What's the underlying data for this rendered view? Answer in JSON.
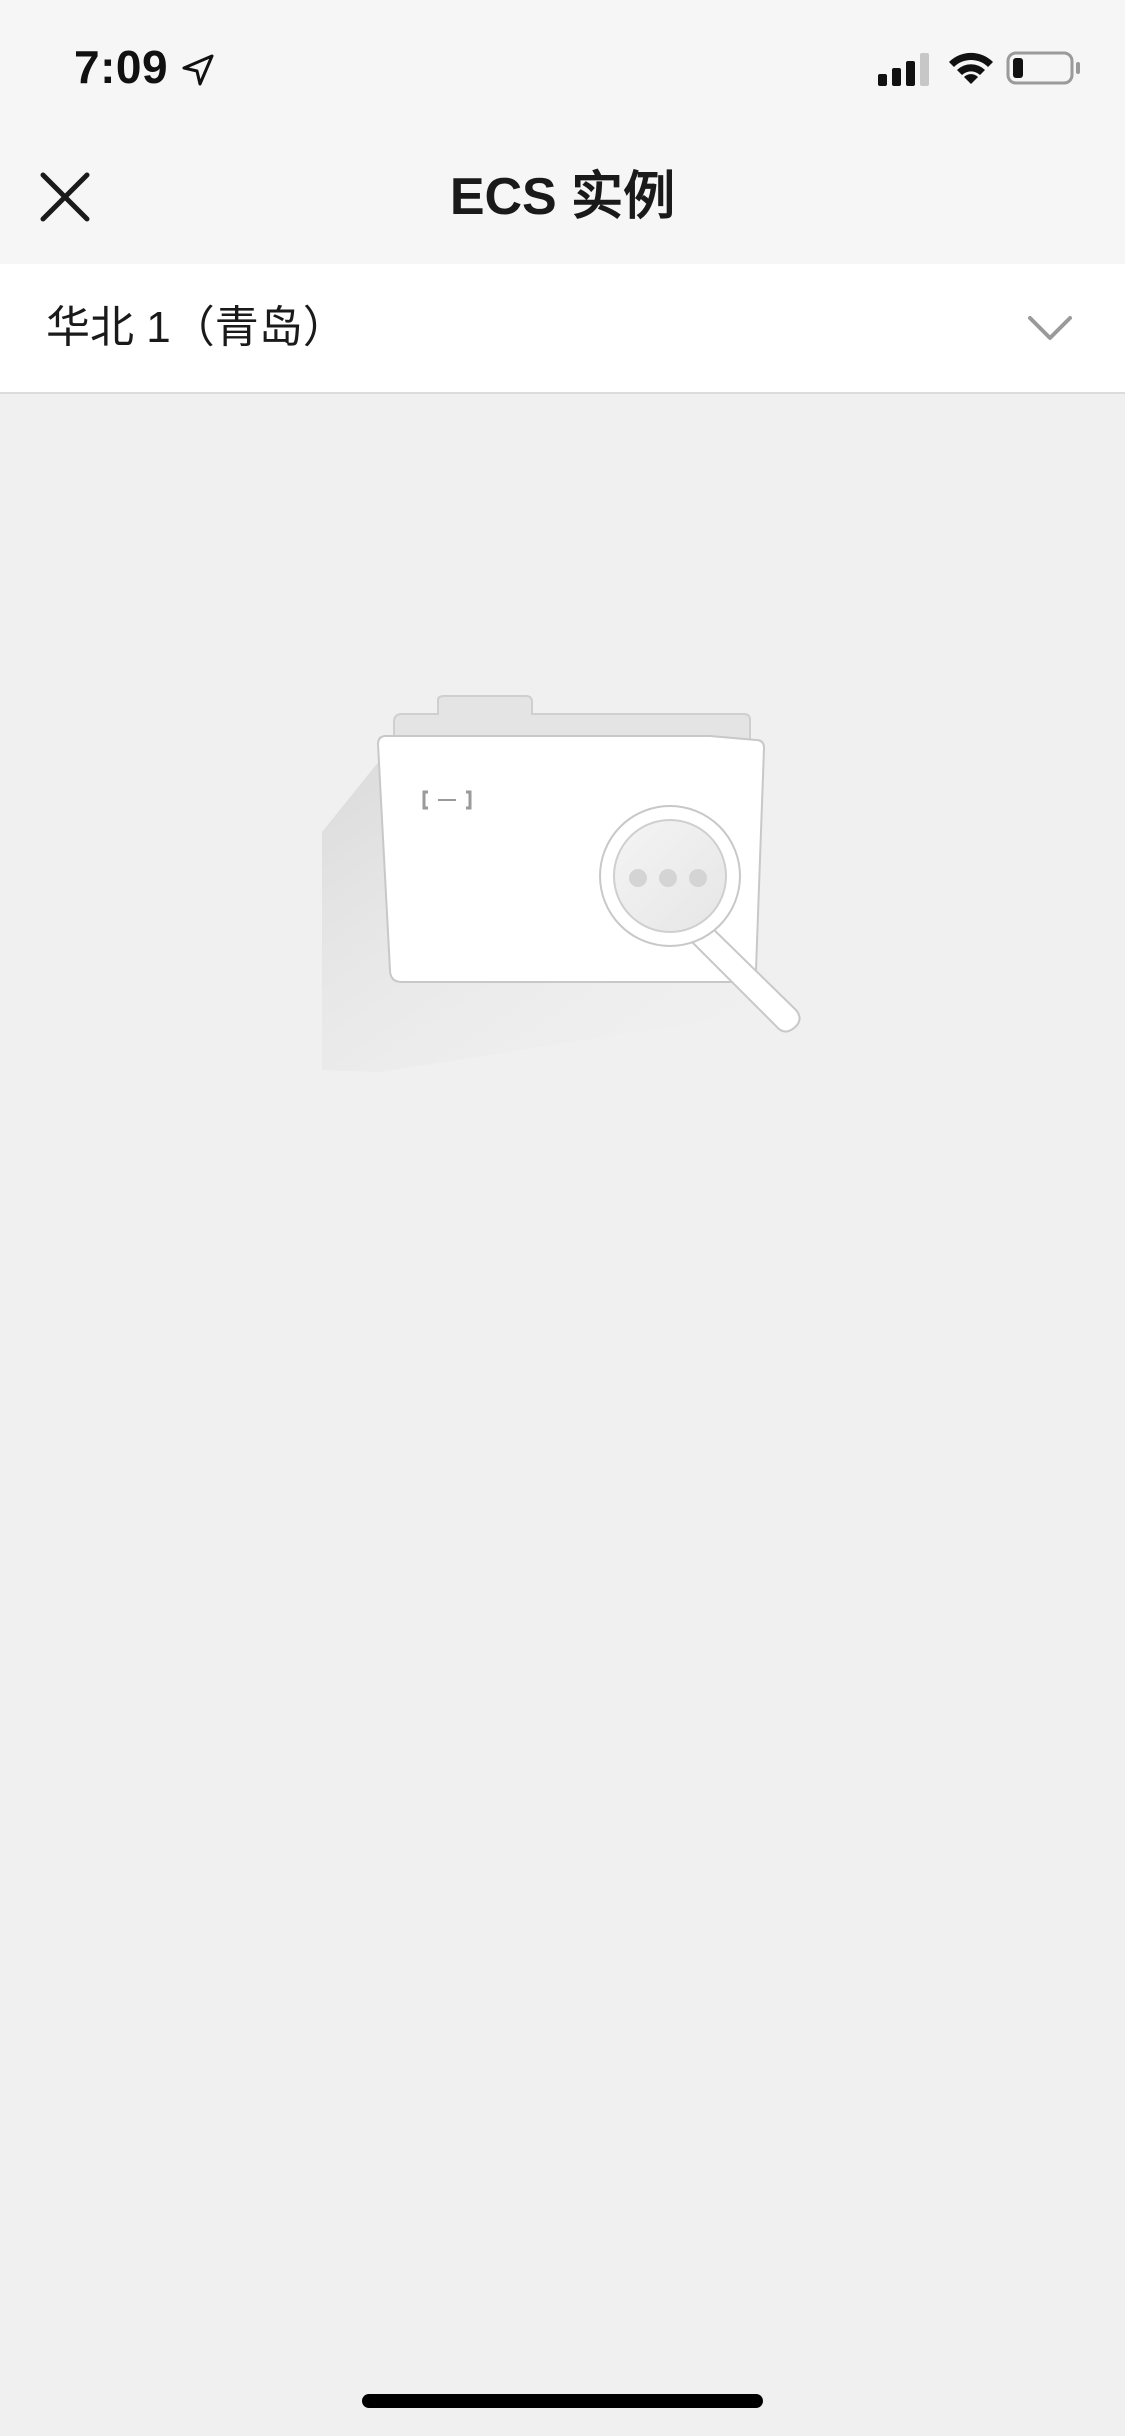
{
  "status_bar": {
    "time": "7:09",
    "icons": [
      "location-arrow-icon",
      "cellular-signal-icon",
      "wifi-icon",
      "battery-icon"
    ]
  },
  "nav": {
    "title": "ECS 实例",
    "close_icon": "close-icon"
  },
  "region_selector": {
    "selected_region": "华北 1（青岛）",
    "icon": "chevron-down-icon"
  },
  "empty_state": {
    "icon": "empty-folder-search-icon"
  },
  "colors": {
    "background": "#f0f0f0",
    "header_background": "#f7f6f7",
    "text_primary": "#1a1a1a",
    "chevron": "#9a9a9a"
  }
}
